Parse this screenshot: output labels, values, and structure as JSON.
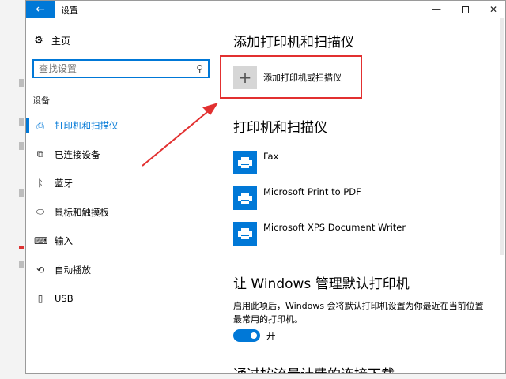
{
  "window": {
    "title": "设置",
    "back_icon": "arrow-left-icon",
    "minimize_glyph": "—",
    "close_glyph": "✕"
  },
  "sidebar": {
    "home_label": "主页",
    "search_placeholder": "查找设置",
    "section_label": "设备",
    "items": [
      {
        "label": "打印机和扫描仪",
        "icon": "printer-icon",
        "glyph": "⎙",
        "active": true
      },
      {
        "label": "已连接设备",
        "icon": "connected-devices-icon",
        "glyph": "⧉",
        "active": false
      },
      {
        "label": "蓝牙",
        "icon": "bluetooth-icon",
        "glyph": "ᛒ",
        "active": false
      },
      {
        "label": "鼠标和触摸板",
        "icon": "mouse-icon",
        "glyph": "⬭",
        "active": false
      },
      {
        "label": "输入",
        "icon": "keyboard-icon",
        "glyph": "⌨",
        "active": false
      },
      {
        "label": "自动播放",
        "icon": "autoplay-icon",
        "glyph": "⟲",
        "active": false
      },
      {
        "label": "USB",
        "icon": "usb-icon",
        "glyph": "▯",
        "active": false
      }
    ]
  },
  "main": {
    "add_heading": "添加打印机和扫描仪",
    "add_button_label": "添加打印机或扫描仪",
    "add_button_glyph": "+",
    "printers_heading": "打印机和扫描仪",
    "printers": [
      {
        "name": "Fax"
      },
      {
        "name": "Microsoft Print to PDF"
      },
      {
        "name": "Microsoft XPS Document Writer"
      }
    ],
    "default_heading": "让 Windows 管理默认打印机",
    "default_description": "启用此项后，Windows 会将默认打印机设置为你最近在当前位置最常用的打印机。",
    "toggle_label": "开",
    "toggle_on": true,
    "metered_heading": "通过按流量计费的连接下载"
  },
  "colors": {
    "accent": "#0078d7",
    "annotation_red": "#e23030"
  }
}
